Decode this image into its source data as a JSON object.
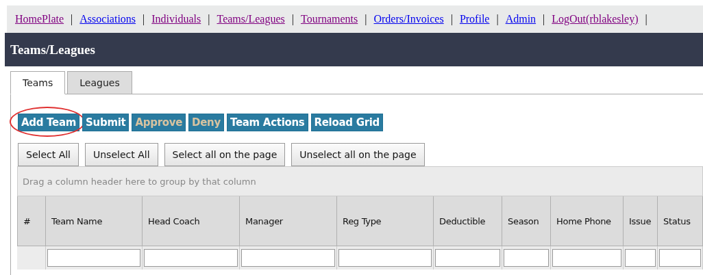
{
  "nav": [
    {
      "label": "HomePlate",
      "visited": true
    },
    {
      "label": "Associations",
      "visited": false
    },
    {
      "label": "Individuals",
      "visited": true
    },
    {
      "label": "Teams/Leagues",
      "visited": true
    },
    {
      "label": "Tournaments",
      "visited": true
    },
    {
      "label": "Orders/Invoices",
      "visited": false
    },
    {
      "label": "Profile",
      "visited": false
    },
    {
      "label": "Admin",
      "visited": false
    },
    {
      "label": "LogOut(rblakesley)",
      "visited": true
    }
  ],
  "separator": "|",
  "page_title": "Teams/Leagues",
  "tabs": [
    {
      "label": "Teams",
      "selected": true
    },
    {
      "label": "Leagues",
      "selected": false
    }
  ],
  "actions": [
    {
      "label": "Add Team",
      "disabled": false,
      "circled": true
    },
    {
      "label": "Submit",
      "disabled": false,
      "circled": false
    },
    {
      "label": "Approve",
      "disabled": true,
      "circled": false
    },
    {
      "label": "Deny",
      "disabled": true,
      "circled": false
    },
    {
      "label": "Team Actions",
      "disabled": false,
      "circled": false
    },
    {
      "label": "Reload Grid",
      "disabled": false,
      "circled": false
    }
  ],
  "select_buttons": [
    "Select All",
    "Unselect All",
    "Select all on the page",
    "Unselect all on the page"
  ],
  "group_hint": "Drag a column header here to group by that column",
  "columns": [
    {
      "label": "#",
      "filter": false
    },
    {
      "label": "Team Name",
      "filter": true
    },
    {
      "label": "Head Coach",
      "filter": true
    },
    {
      "label": "Manager",
      "filter": true
    },
    {
      "label": "Reg Type",
      "filter": true
    },
    {
      "label": "Deductible",
      "filter": true
    },
    {
      "label": "Season",
      "filter": true
    },
    {
      "label": "Home Phone",
      "filter": true
    },
    {
      "label": "Issue",
      "filter": true
    },
    {
      "label": "Status",
      "filter": true
    }
  ]
}
